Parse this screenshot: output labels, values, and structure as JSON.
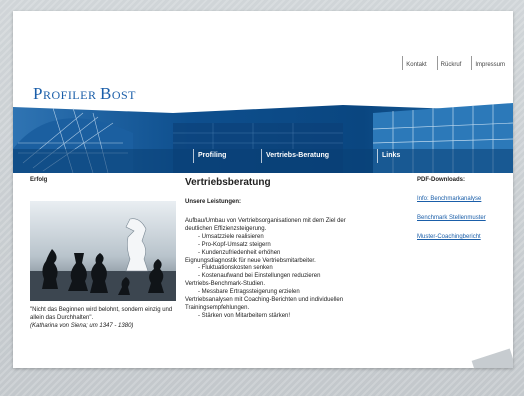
{
  "brand": {
    "logo_line1": "P",
    "logo_rest1": "ROFILER ",
    "logo_line2": "B",
    "logo_rest2": "OST"
  },
  "topnav": {
    "items": [
      "Kontakt",
      "Rückruf",
      "Impressum"
    ]
  },
  "mainnav": {
    "items": [
      "Profiling",
      "Vertriebs-Beratung",
      "Links"
    ]
  },
  "left": {
    "heading": "Erfolg",
    "quote": "\"Nicht das Beginnen wird belohnt, sondern einzig und allein das Durchhalten\".",
    "quote_author": "(Katharina von Siena; um 1347 - 1380)"
  },
  "main": {
    "title": "Vertriebsberatung",
    "subtitle": "Unsere Leistungen:",
    "lines": [
      {
        "text": "Aufbau/Umbau von Vertriebsorganisationen mit dem Ziel der",
        "indent": false
      },
      {
        "text": "deutlichen Effizienzsteigerung.",
        "indent": false
      },
      {
        "text": "- Umsatzziele realisieren",
        "indent": true
      },
      {
        "text": "- Pro-Kopf-Umsatz steigern",
        "indent": true
      },
      {
        "text": "- Kundenzufriedenheit erhöhen",
        "indent": true
      },
      {
        "text": "Eignungsdiagnostik für neue Vertriebsmitarbeiter.",
        "indent": false
      },
      {
        "text": "- Fluktuationskosten senken",
        "indent": true
      },
      {
        "text": "- Kostenaufwand bei Einstellungen reduzieren",
        "indent": true
      },
      {
        "text": "Vertriebs-Benchmark-Studien.",
        "indent": false
      },
      {
        "text": "- Messbare Ertragssteigerung erzielen",
        "indent": true
      },
      {
        "text": "Vertriebsanalysen mit Coaching-Berichten und individuellen",
        "indent": false
      },
      {
        "text": "Trainingsempfehlungen.",
        "indent": false
      },
      {
        "text": "- Stärken von Mitarbeitern stärken!",
        "indent": true
      }
    ]
  },
  "downloads": {
    "heading": "PDF-Downloads:",
    "items": [
      "Info: Benchmarkanalyse",
      "Benchmark Stellenmuster",
      "Muster-Coachingbericht"
    ]
  },
  "colors": {
    "brand_blue": "#1a5ea9",
    "banner_dark": "#0d4f8c"
  }
}
